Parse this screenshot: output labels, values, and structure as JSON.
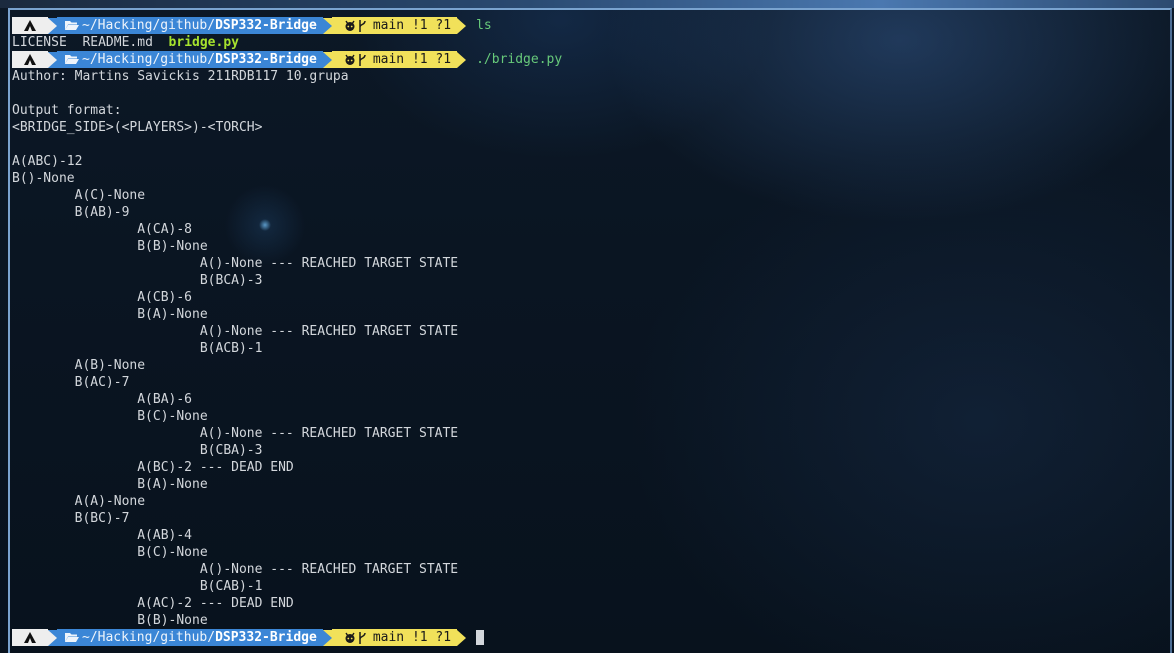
{
  "prompt": {
    "path_prefix": "~/Hacking/github/",
    "path_dir": "DSP332-Bridge",
    "branch": "main !1 ?1"
  },
  "commands": {
    "ls": "ls",
    "run": "./bridge.py"
  },
  "ls_output": {
    "files": [
      "LICENSE",
      "README.md"
    ],
    "exec_file": "bridge.py"
  },
  "output": [
    "Author: Martins Savickis 211RDB117 10.grupa",
    "",
    "Output format:",
    "<BRIDGE_SIDE>(<PLAYERS>)-<TORCH>",
    "",
    "A(ABC)-12",
    "B()-None",
    "        A(C)-None",
    "        B(AB)-9",
    "                A(CA)-8",
    "                B(B)-None",
    "                        A()-None --- REACHED TARGET STATE",
    "                        B(BCA)-3",
    "                A(CB)-6",
    "                B(A)-None",
    "                        A()-None --- REACHED TARGET STATE",
    "                        B(ACB)-1",
    "        A(B)-None",
    "        B(AC)-7",
    "                A(BA)-6",
    "                B(C)-None",
    "                        A()-None --- REACHED TARGET STATE",
    "                        B(CBA)-3",
    "                A(BC)-2 --- DEAD END",
    "                B(A)-None",
    "        A(A)-None",
    "        B(BC)-7",
    "                A(AB)-4",
    "                B(C)-None",
    "                        A()-None --- REACHED TARGET STATE",
    "                        B(CAB)-1",
    "                A(AC)-2 --- DEAD END",
    "                B(B)-None"
  ],
  "icons": {
    "os": "arch-linux-icon",
    "folder": "folder-open-icon",
    "git": "github-icon",
    "branch": "git-branch-icon"
  },
  "colors": {
    "path_segment": "#3b86d6",
    "git_segment": "#f1e15a",
    "command": "#67c97a",
    "executable": "#a6e22e"
  }
}
